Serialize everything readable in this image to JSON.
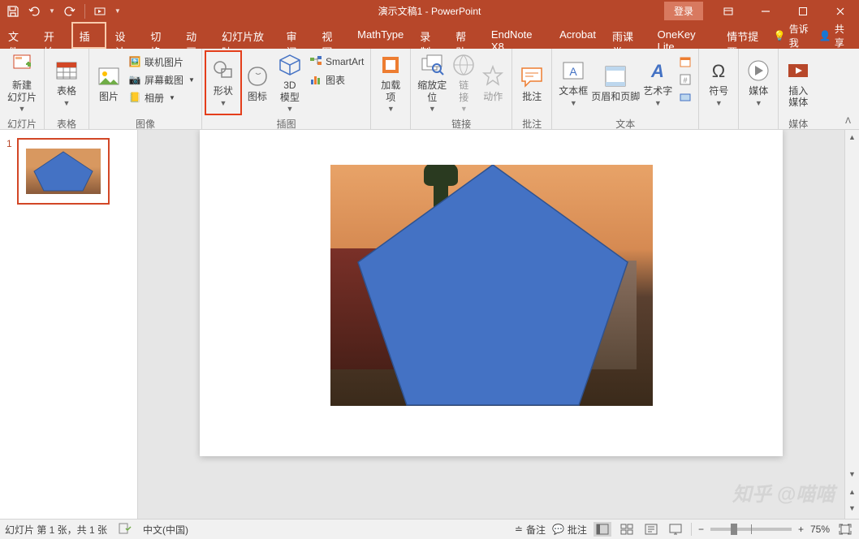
{
  "titlebar": {
    "doc_title": "演示文稿1  -  PowerPoint",
    "login": "登录"
  },
  "tabs": {
    "file": "文件",
    "home": "开始",
    "insert": "插入",
    "design": "设计",
    "transitions": "切换",
    "animations": "动画",
    "slideshow": "幻灯片放映",
    "review": "审阅",
    "view": "视图",
    "mathtype": "MathType",
    "record": "录制",
    "help": "帮助",
    "endnote": "EndNote X8",
    "acrobat": "Acrobat",
    "rain": "雨课堂",
    "onekey": "OneKey Lite",
    "storyboard": "情节提要",
    "tell_me": "告诉我",
    "share": "共享"
  },
  "ribbon": {
    "group_slides": "幻灯片",
    "new_slide": "新建\n幻灯片",
    "group_tables": "表格",
    "table": "表格",
    "group_images": "图像",
    "picture": "图片",
    "online_pic": "联机图片",
    "screenshot": "屏幕截图",
    "album": "相册",
    "group_illus": "插图",
    "shapes": "形状",
    "icons": "图标",
    "model3d": "3D\n模型",
    "smartart": "SmartArt",
    "chart": "图表",
    "group_addins": "",
    "addin": "加载\n项",
    "group_links": "链接",
    "zoom": "缩放定\n位",
    "link": "链\n接",
    "action": "动作",
    "group_comments": "批注",
    "comment": "批注",
    "group_text": "文本",
    "textbox": "文本框",
    "header_footer": "页眉和页脚",
    "wordart": "艺术字",
    "group_symbols": "",
    "symbol": "符号",
    "group_media": "",
    "media": "媒体",
    "group_insert_media": "媒体",
    "insert_media": "插入\n媒体"
  },
  "thumbs": {
    "num1": "1"
  },
  "status": {
    "slide_info": "幻灯片 第 1 张，共 1 张",
    "lang": "中文(中国)",
    "notes": "备注",
    "comments": "批注",
    "zoom": "75%"
  },
  "watermark": "知乎 @喵喵"
}
